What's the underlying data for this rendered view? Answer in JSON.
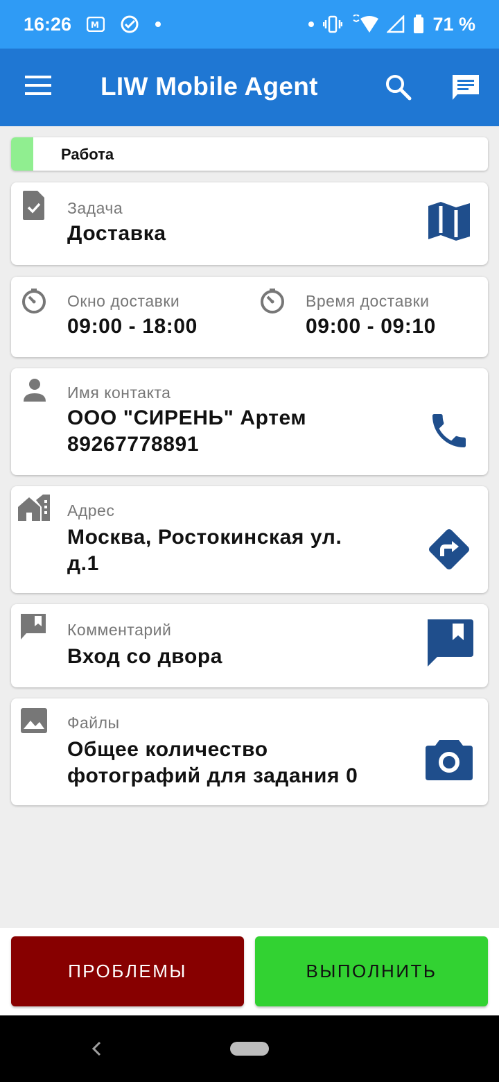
{
  "status_bar": {
    "time": "16:26",
    "battery": "71 %"
  },
  "app_bar": {
    "title": "LIW Mobile Agent",
    "icons": [
      "menu-icon",
      "search-icon",
      "chat-icon"
    ]
  },
  "status": {
    "label": "Работа",
    "color": "#90ee90"
  },
  "task": {
    "caption": "Задача",
    "value": "Доставка"
  },
  "delivery_window": {
    "caption": "Окно доставки",
    "value": "09:00 - 18:00"
  },
  "delivery_time": {
    "caption": "Время доставки",
    "value": "09:00 - 09:10"
  },
  "contact": {
    "caption": "Имя контакта",
    "name": "ООО \"СИРЕНЬ\" Артем",
    "phone": "89267778891"
  },
  "address": {
    "caption": "Адрес",
    "line1": "Москва, Ростокинская ул.",
    "line2": "д.1"
  },
  "comment": {
    "caption": "Комментарий",
    "value": "Вход со двора"
  },
  "files": {
    "caption": "Файлы",
    "line1": "Общее количество",
    "line2": "фотографий для задания 0"
  },
  "buttons": {
    "problems": "ПРОБЛЕМЫ",
    "complete": "ВЫПОЛНИТЬ"
  },
  "colors": {
    "status_bar": "#2f9bf5",
    "app_bar": "#1f77d3",
    "accent_icon": "#1f4e8c",
    "problems": "#870000",
    "complete": "#32d232"
  }
}
